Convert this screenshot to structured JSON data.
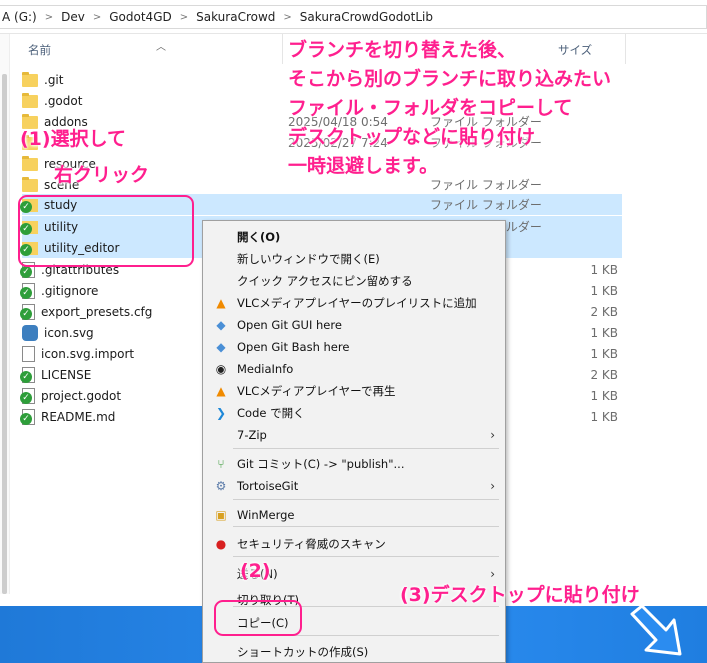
{
  "address": {
    "crumbs": [
      "A (G:)",
      "Dev",
      "Godot4GD",
      "SakuraCrowd",
      "SakuraCrowdGodotLib"
    ]
  },
  "columns": {
    "name": "名前",
    "size": "サイズ"
  },
  "files": [
    {
      "name": ".git",
      "date": "",
      "type": "",
      "size": "",
      "icon": "folder-icon"
    },
    {
      "name": ".godot",
      "date": "",
      "type": "",
      "size": "",
      "icon": "folder-icon"
    },
    {
      "name": "addons",
      "date": "2025/04/18 0:54",
      "type": "ファイル フォルダー",
      "size": "",
      "icon": "folder-icon"
    },
    {
      "name": "",
      "date": "2025/02/27 7:24",
      "type": "ファイル フォルダー",
      "size": "",
      "icon": "folder-icon"
    },
    {
      "name": "resource",
      "date": "",
      "type": "",
      "size": "",
      "icon": "folder-icon"
    },
    {
      "name": "scene",
      "date": "",
      "type": "ファイル フォルダー",
      "size": "",
      "icon": "folder-icon"
    },
    {
      "name": "study",
      "date": "",
      "type": "ファイル フォルダー",
      "size": "",
      "icon": "git-folder-icon"
    },
    {
      "name": "utility",
      "date": "",
      "type": "ファイル フォルダー",
      "size": "",
      "icon": "git-folder-icon"
    },
    {
      "name": "utility_editor",
      "date": "",
      "type": "",
      "size": "",
      "icon": "git-folder-icon"
    },
    {
      "name": ".gitattributes",
      "date": "",
      "type": "",
      "size": "1 KB",
      "icon": "git-file-icon"
    },
    {
      "name": ".gitignore",
      "date": "",
      "type": "",
      "size": "1 KB",
      "icon": "git-file-icon"
    },
    {
      "name": "export_presets.cfg",
      "date": "",
      "type": "",
      "size": "2 KB",
      "icon": "git-file-icon"
    },
    {
      "name": "icon.svg",
      "date": "",
      "type": "",
      "size": "1 KB",
      "icon": "godot-icon"
    },
    {
      "name": "icon.svg.import",
      "date": "",
      "type": "",
      "size": "1 KB",
      "icon": "file-icon"
    },
    {
      "name": "LICENSE",
      "date": "",
      "type": "",
      "size": "2 KB",
      "icon": "git-file-icon"
    },
    {
      "name": "project.godot",
      "date": "",
      "type": "",
      "size": "1 KB",
      "icon": "git-file-icon"
    },
    {
      "name": "README.md",
      "date": "",
      "type": "",
      "size": "1 KB",
      "icon": "git-file-icon"
    }
  ],
  "menu": {
    "items": [
      {
        "label": "開く(O)",
        "icon": "",
        "bold": true
      },
      {
        "label": "新しいウィンドウで開く(E)",
        "icon": ""
      },
      {
        "label": "クイック アクセスにピン留めする",
        "icon": ""
      },
      {
        "label": "VLCメディアプレイヤーのプレイリストに追加",
        "icon": "vlc-icon"
      },
      {
        "label": "Open Git GUI here",
        "icon": "git-gui-icon"
      },
      {
        "label": "Open Git Bash here",
        "icon": "git-bash-icon"
      },
      {
        "label": "MediaInfo",
        "icon": "mediainfo-icon"
      },
      {
        "label": "VLCメディアプレイヤーで再生",
        "icon": "vlc-icon"
      },
      {
        "label": "Code で開く",
        "icon": "vscode-icon"
      },
      {
        "label": "7-Zip",
        "icon": "",
        "submenu": true
      },
      {
        "label": "Git コミット(C) -> \"publish\"...",
        "icon": "git-commit-icon"
      },
      {
        "label": "TortoiseGit",
        "icon": "tortoisegit-icon",
        "submenu": true
      },
      {
        "label": "WinMerge",
        "icon": "winmerge-icon"
      },
      {
        "label": "セキュリティ脅威のスキャン",
        "icon": "security-scan-icon"
      },
      {
        "label": "送る(N)",
        "icon": "",
        "submenu": true
      },
      {
        "label": "切り取り(T)",
        "icon": ""
      },
      {
        "label": "コピー(C)",
        "icon": ""
      },
      {
        "label": "ショートカットの作成(S)",
        "icon": ""
      }
    ]
  },
  "annotations": {
    "note_line1": "ブランチを切り替えた後、",
    "note_line2": "そこから別のブランチに取り込みたい",
    "note_line3": "ファイル・フォルダをコピーして",
    "note_line4": "デスクトップなどに貼り付け",
    "note_line5": "一時退避します。",
    "step1_line1": "(1)選択して",
    "step1_line2": "右クリック",
    "step2": "(2)",
    "step3": "(3)デスクトップに貼り付け"
  },
  "colors": {
    "annotation": "#ff1f8e",
    "selection": "#cce8ff",
    "desktop": "#2b8cf0"
  }
}
